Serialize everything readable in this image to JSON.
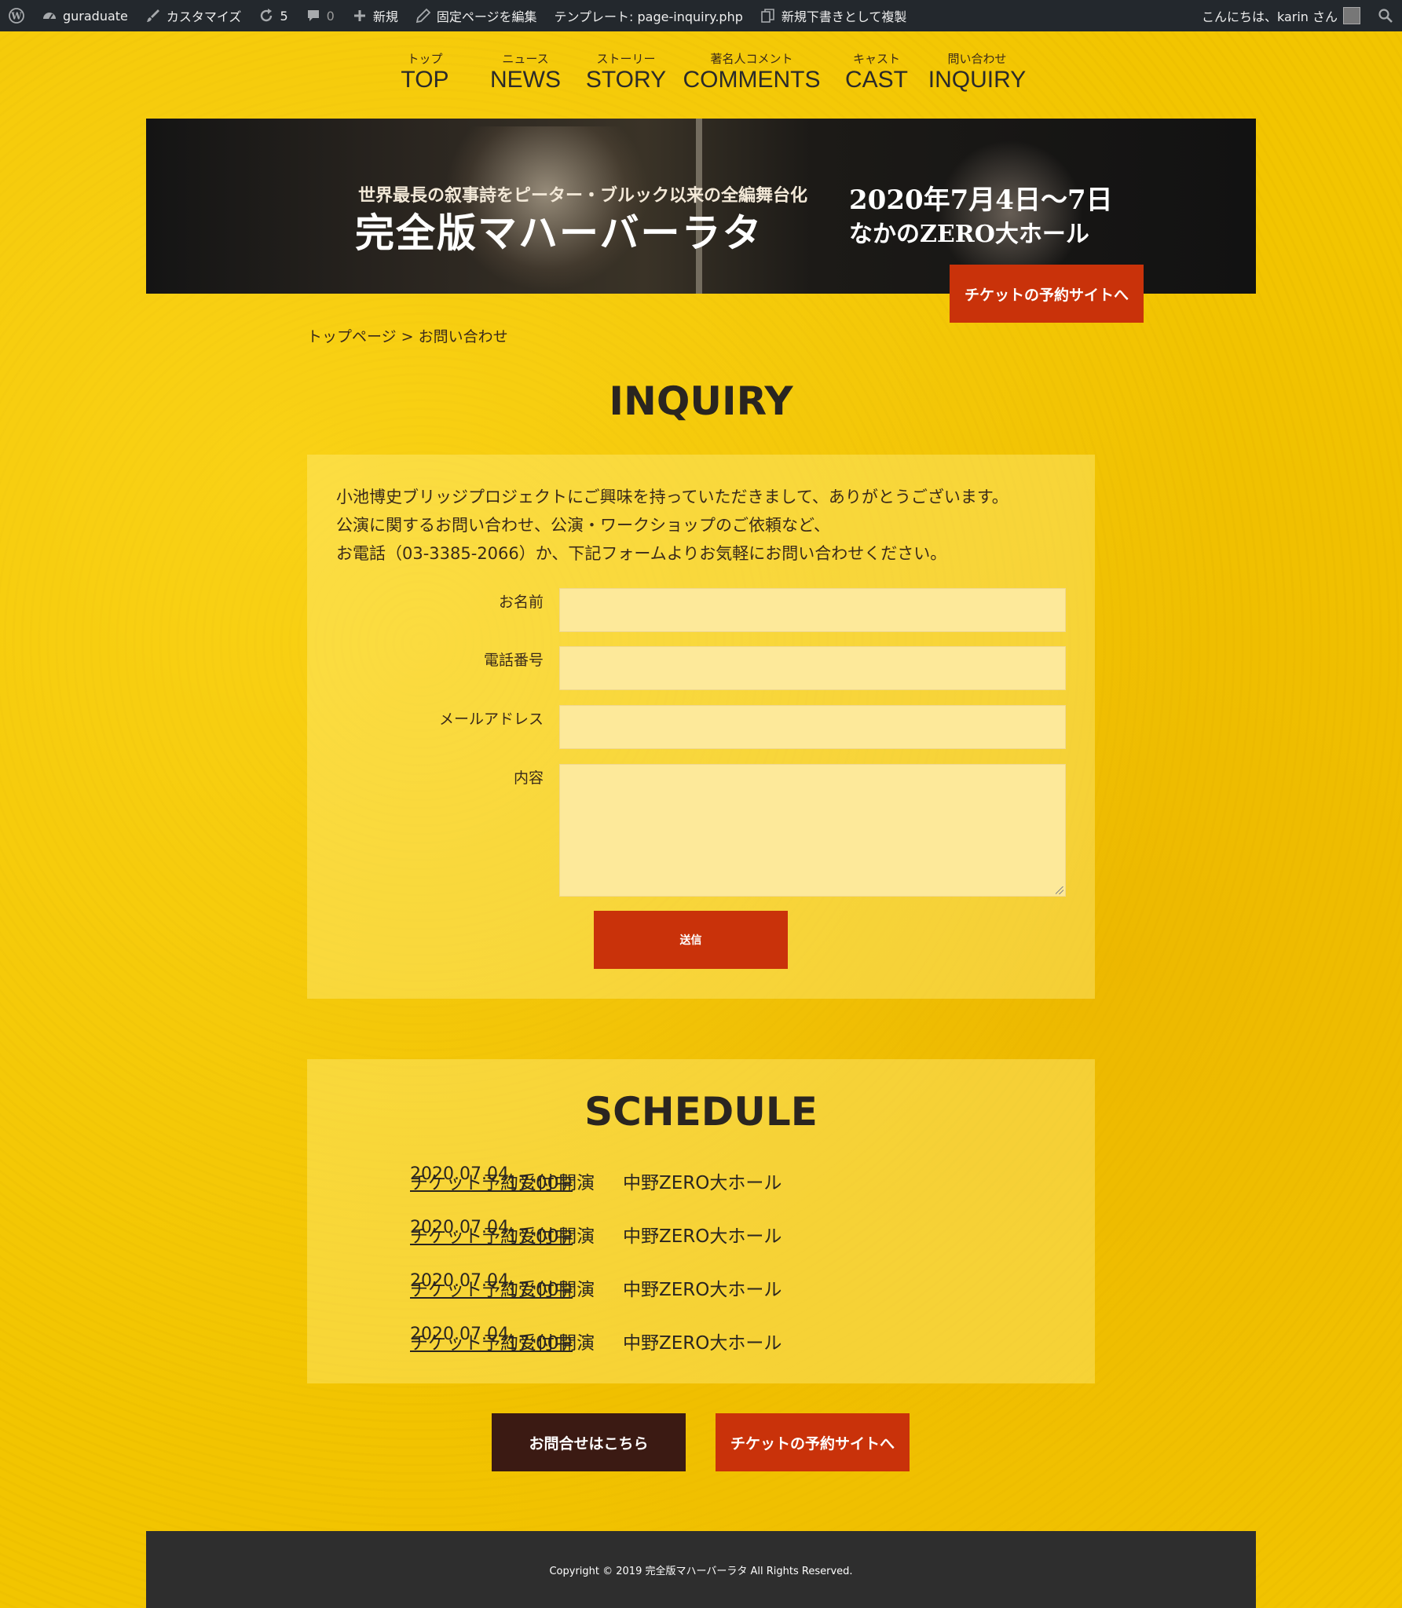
{
  "admin_bar": {
    "site_name": "guraduate",
    "customize": "カスタマイズ",
    "updates_count": "5",
    "comments_count": "0",
    "new": "新規",
    "edit_page": "固定ページを編集",
    "template": "テンプレート: page-inquiry.php",
    "duplicate": "新規下書きとして複製",
    "greeting": "こんにちは、karin さん"
  },
  "nav": [
    {
      "ruby": "トップ",
      "label": "TOP"
    },
    {
      "ruby": "ニュース",
      "label": "NEWS"
    },
    {
      "ruby": "ストーリー",
      "label": "STORY"
    },
    {
      "ruby": "著名人コメント",
      "label": "COMMENTS"
    },
    {
      "ruby": "キャスト",
      "label": "CAST"
    },
    {
      "ruby": "問い合わせ",
      "label": "INQUIRY"
    }
  ],
  "hero": {
    "subtitle": "世界最長の叙事詩をピーター・ブルック以来の全編舞台化",
    "title": "完全版マハーバーラタ",
    "date": "2020年7月4日〜7日",
    "venue": "なかのZERO大ホール"
  },
  "ticket_button": "チケットの予約サイトへ",
  "breadcrumb": "トップページ > お問い合わせ",
  "inquiry": {
    "heading": "INQUIRY",
    "intro": [
      "小池博史ブリッジプロジェクトにご興味を持っていただきまして、ありがとうございます。",
      "公演に関するお問い合わせ、公演・ワークショップのご依頼など、",
      "お電話（03-3385-2066）か、下記フォームよりお気軽にお問い合わせください。"
    ],
    "fields": {
      "name": "お名前",
      "phone": "電話番号",
      "email": "メールアドレス",
      "content": "内容"
    },
    "submit": "送信"
  },
  "schedule": {
    "heading": "SCHEDULE",
    "rows": [
      {
        "date": "2020.07.04",
        "time": "17:00開演",
        "venue": "中野ZERO大ホール",
        "status": "チケット予約受付中"
      },
      {
        "date": "2020.07.04",
        "time": "17:00開演",
        "venue": "中野ZERO大ホール",
        "status": "チケット予約受付中"
      },
      {
        "date": "2020.07.04",
        "time": "17:00開演",
        "venue": "中野ZERO大ホール",
        "status": "チケット予約受付中"
      },
      {
        "date": "2020.07.04",
        "time": "17:00開演",
        "venue": "中野ZERO大ホール",
        "status": "チケット予約受付中"
      }
    ]
  },
  "contact_button": "お問合せはこちら",
  "footer": {
    "copyright": "Copyright © 2019 完全版マハーバーラタ All Rights Reserved."
  },
  "colors": {
    "background": "#f2c500",
    "accent_red": "#c9320a",
    "dark_brown": "#3b1a13",
    "admin_bar": "#23282d",
    "footer": "#2e2e2e"
  }
}
